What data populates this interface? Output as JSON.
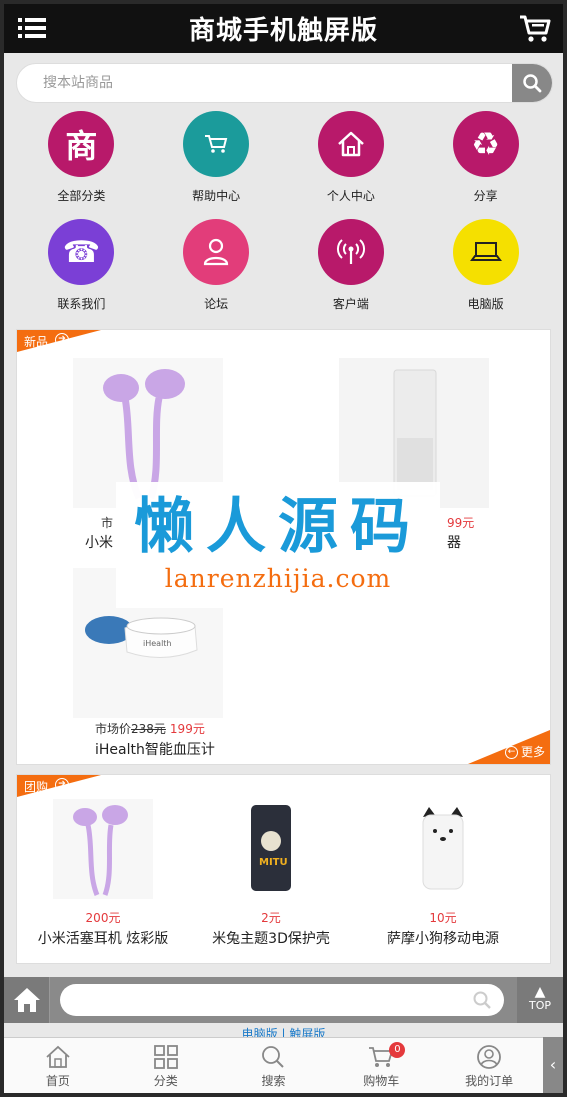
{
  "header": {
    "title": "商城手机触屏版",
    "menu_icon": "menu-icon",
    "cart_icon": "cart-icon"
  },
  "search": {
    "placeholder": "搜本站商品",
    "icon": "search-icon"
  },
  "nav_grid": [
    {
      "label": "全部分类",
      "icon": "shop-char-icon",
      "glyph": "商",
      "color": "#b8196a"
    },
    {
      "label": "帮助中心",
      "icon": "cart-icon",
      "glyph": "",
      "color": "#1b9b9b"
    },
    {
      "label": "个人中心",
      "icon": "home-icon",
      "glyph": "",
      "color": "#b8196a"
    },
    {
      "label": "分享",
      "icon": "recycle-icon",
      "glyph": "♻",
      "color": "#b8196a"
    },
    {
      "label": "联系我们",
      "icon": "phone-icon",
      "glyph": "☎",
      "color": "#7b3fd6"
    },
    {
      "label": "论坛",
      "icon": "user-icon",
      "glyph": "",
      "color": "#e23d7a"
    },
    {
      "label": "客户端",
      "icon": "signal-icon",
      "glyph": "",
      "color": "#b8196a"
    },
    {
      "label": "电脑版",
      "icon": "laptop-icon",
      "glyph": "",
      "color": "#f5e000"
    }
  ],
  "new_products": {
    "tag": "新品",
    "more": "更多",
    "items": [
      {
        "market_prefix": "市场价",
        "old_price": "",
        "price": "",
        "name": "小米活"
      },
      {
        "market_prefix": "",
        "old_price": "",
        "price": "99元",
        "name": "器"
      },
      {
        "market_prefix": "市场价",
        "old_price": "238元",
        "price": "199元",
        "name": "iHealth智能血压计"
      }
    ],
    "partial_left_price": "市",
    "partial_left_name": "小米"
  },
  "watermark": {
    "big": "懒人源码",
    "small": "lanrenzhijia.com"
  },
  "group_buy": {
    "tag": "团购",
    "items": [
      {
        "price": "200元",
        "name": "小米活塞耳机 炫彩版"
      },
      {
        "price": "2元",
        "name": "米兔主题3D保护壳"
      },
      {
        "price": "10元",
        "name": "萨摩小狗移动电源"
      }
    ]
  },
  "footer_bar": {
    "top_label": "TOP",
    "links_hint": "电脑版 | 触屏版"
  },
  "tabbar": [
    {
      "label": "首页",
      "icon": "home-outline-icon"
    },
    {
      "label": "分类",
      "icon": "category-icon"
    },
    {
      "label": "搜索",
      "icon": "search-icon"
    },
    {
      "label": "购物车",
      "icon": "cart-icon",
      "badge": "0"
    },
    {
      "label": "我的订单",
      "icon": "user-circle-icon"
    }
  ]
}
